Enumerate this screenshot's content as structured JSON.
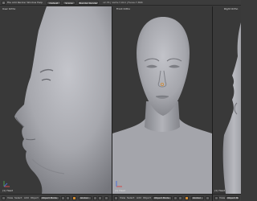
{
  "header": {
    "menu": "File  Add  Render  Window  Help",
    "layout_name": "Default",
    "scene_name": "Scene",
    "render_engine": "Blender Render",
    "info": "v2.76 | Verts:7,914 | Faces:7,868"
  },
  "viewports": [
    {
      "label": "User Ortho",
      "object": "(1) Head"
    },
    {
      "label": "Front Ortho",
      "object": "(1) Head"
    },
    {
      "label": "Right Ortho",
      "object": "(1) Head"
    }
  ],
  "bottom_bars": [
    {
      "view": "View",
      "select": "Select",
      "add": "Add",
      "object": "Object",
      "mode": "Object Mode",
      "global": "Global"
    },
    {
      "view": "View",
      "select": "Select",
      "add": "Add",
      "object": "Object",
      "mode": "Object Mode",
      "global": "Global"
    },
    {
      "view": "View",
      "mode": "Object Mode"
    }
  ],
  "colors": {
    "viewport_bg": "#393939",
    "mesh": "#a9aab0",
    "header": "#3c3c3c",
    "accent": "#d08a32"
  }
}
